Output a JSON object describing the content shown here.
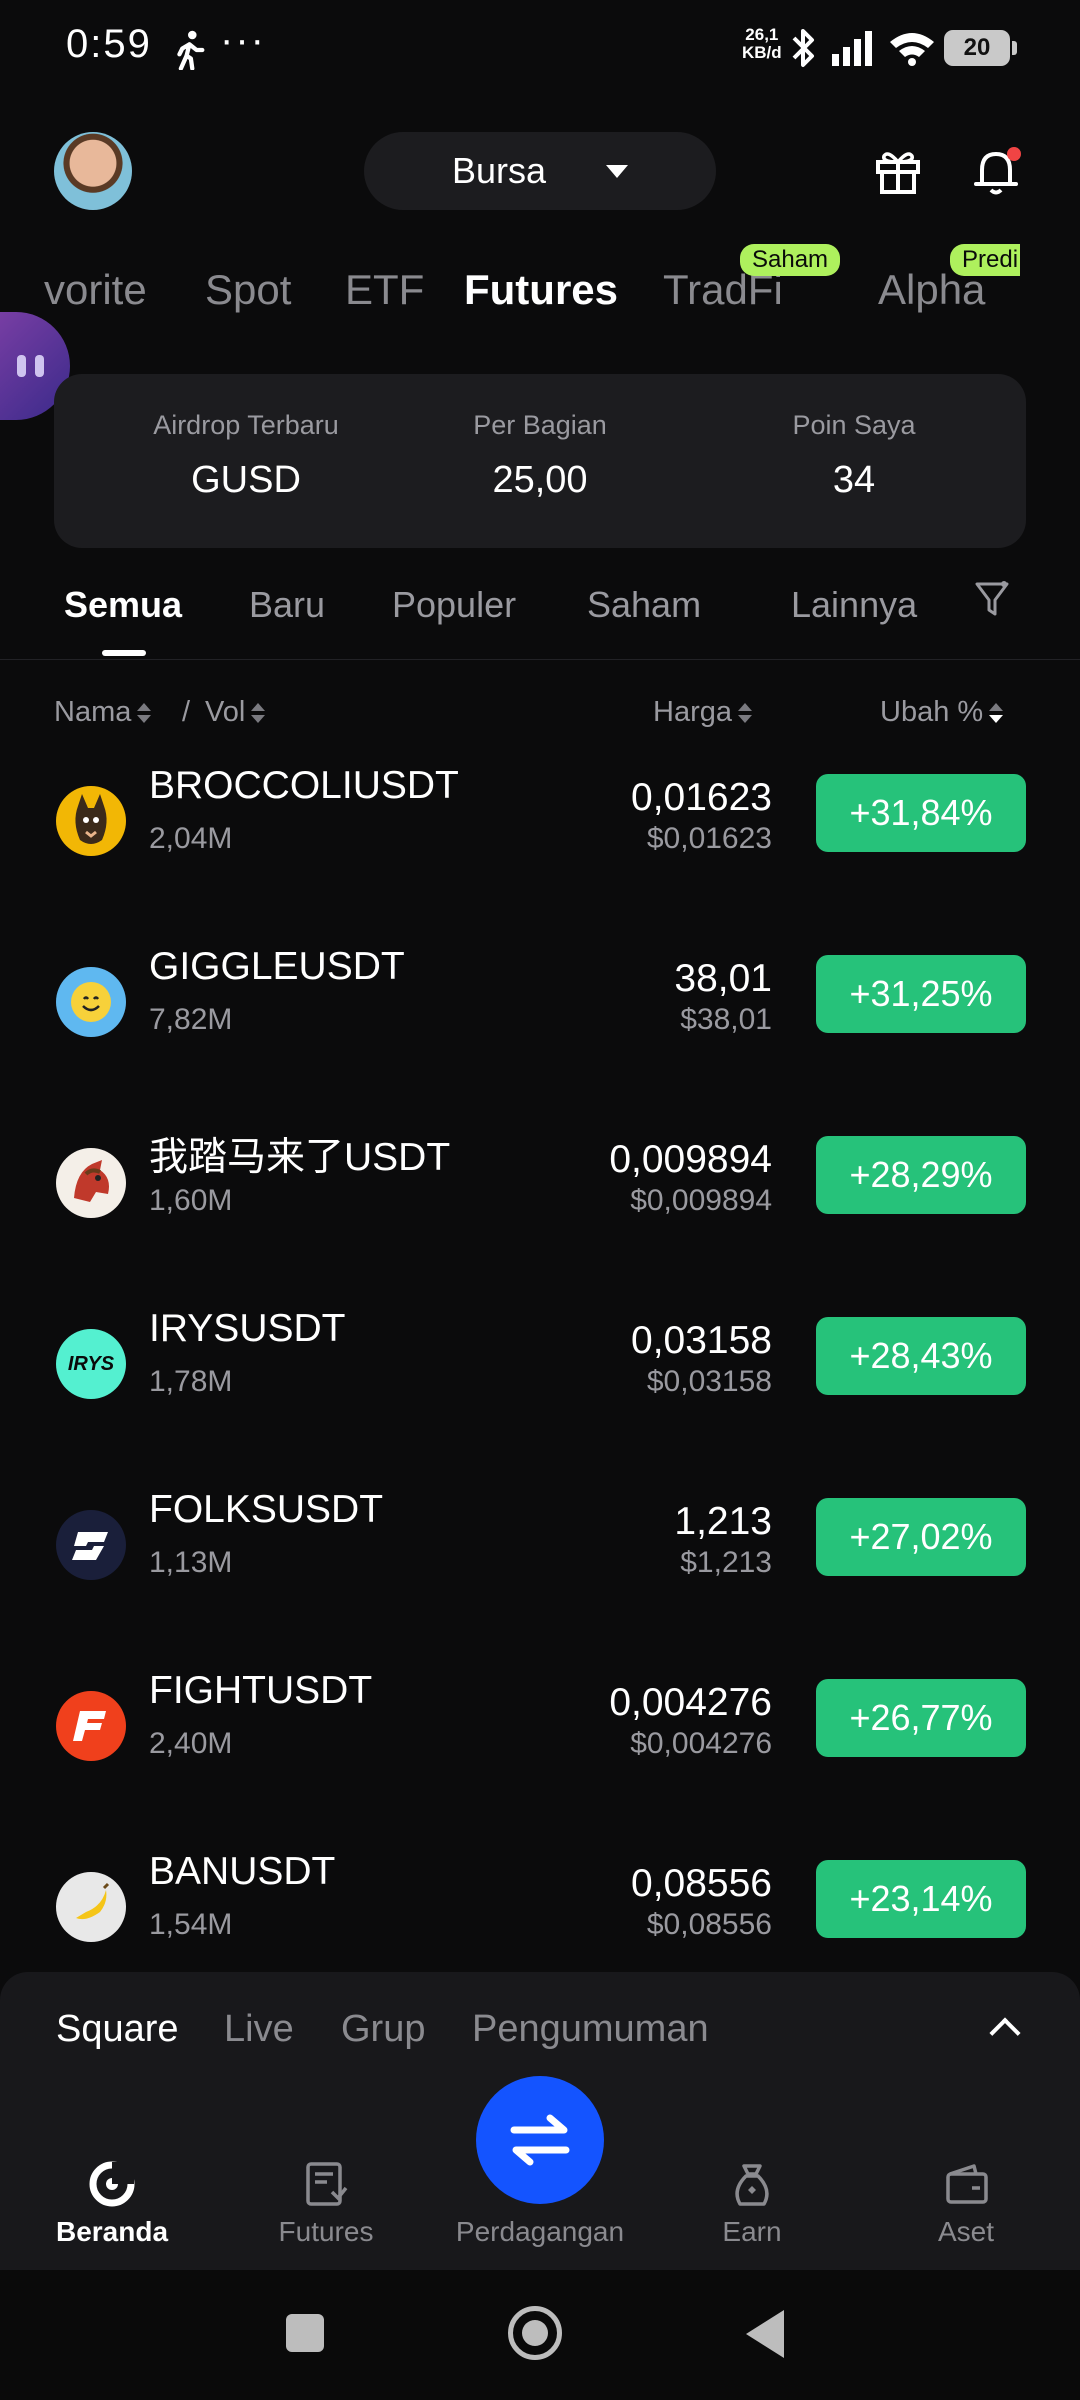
{
  "status_bar": {
    "time": "0:59",
    "dots": "···",
    "net_speed_value": "26,1",
    "net_speed_unit": "KB/d",
    "battery": "20"
  },
  "header": {
    "exchange_label": "Bursa"
  },
  "top_tabs": [
    {
      "label": "vorite"
    },
    {
      "label": "Spot"
    },
    {
      "label": "ETF"
    },
    {
      "label": "Futures",
      "active": true
    },
    {
      "label": "TradFi",
      "tag": "Saham"
    },
    {
      "label": "Alpha",
      "tag": "Predi"
    }
  ],
  "airdrop": {
    "col1_label": "Airdrop Terbaru",
    "col1_value": "GUSD",
    "col2_label": "Per Bagian",
    "col2_value": "25,00",
    "col3_label": "Poin Saya",
    "col3_value": "34"
  },
  "filter_tabs": [
    "Semua",
    "Baru",
    "Populer",
    "Saham",
    "Lainnya"
  ],
  "columns": {
    "name": "Nama",
    "separator": "/",
    "vol": "Vol",
    "price": "Harga",
    "change": "Ubah %"
  },
  "rows": [
    {
      "name": "BROCCOLIUSDT",
      "vol": "2,04M",
      "price": "0,01623",
      "usd": "$0,01623",
      "change": "+31,84%",
      "icon_color": "#f2b705",
      "icon": "broccoli-dog-icon"
    },
    {
      "name": "GIGGLEUSDT",
      "vol": "7,82M",
      "price": "38,01",
      "usd": "$38,01",
      "change": "+31,25%",
      "icon_color": "#5fb8f0",
      "icon": "giggle-smile-icon"
    },
    {
      "name": "我踏马来了USDT",
      "vol": "1,60M",
      "price": "0,009894",
      "usd": "$0,009894",
      "change": "+28,29%",
      "icon_color": "#f4efe8",
      "icon": "horse-icon"
    },
    {
      "name": "IRYSUSDT",
      "vol": "1,78M",
      "price": "0,03158",
      "usd": "$0,03158",
      "change": "+28,43%",
      "icon_color": "#54f0d0",
      "icon": "irys-icon",
      "icon_text": "IRYS"
    },
    {
      "name": "FOLKSUSDT",
      "vol": "1,13M",
      "price": "1,213",
      "usd": "$1,213",
      "change": "+27,02%",
      "icon_color": "#1a1f3a",
      "icon": "folks-icon"
    },
    {
      "name": "FIGHTUSDT",
      "vol": "2,40M",
      "price": "0,004276",
      "usd": "$0,004276",
      "change": "+26,77%",
      "icon_color": "#f0401c",
      "icon": "fight-icon"
    },
    {
      "name": "BANUSDT",
      "vol": "1,54M",
      "price": "0,08556",
      "usd": "$0,08556",
      "change": "+23,14%",
      "icon_color": "#e8e8e8",
      "icon": "banana-icon"
    }
  ],
  "square_tabs": [
    "Square",
    "Live",
    "Grup",
    "Pengumuman"
  ],
  "bottom_nav": [
    {
      "label": "Beranda",
      "icon": "home-icon",
      "active": true
    },
    {
      "label": "Futures",
      "icon": "futures-icon"
    },
    {
      "label": "Perdagangan",
      "icon": "trade-swap-icon"
    },
    {
      "label": "Earn",
      "icon": "earn-icon"
    },
    {
      "label": "Aset",
      "icon": "wallet-icon"
    }
  ],
  "colors": {
    "background": "#0b0b0c",
    "card": "#1c1c1f",
    "positive": "#26c27a",
    "accent_blue": "#1454ff",
    "tag_green": "#aef05d"
  }
}
